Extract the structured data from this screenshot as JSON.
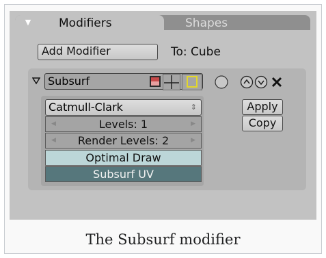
{
  "tabs": {
    "modifiers_label": "Modifiers",
    "shapes_label": "Shapes"
  },
  "toolbar": {
    "add_modifier_label": "Add Modifier",
    "target_label": "To: Cube"
  },
  "modifier": {
    "name": "Subsurf",
    "subdivision_type": "Catmull-Clark",
    "levels_label": "Levels: 1",
    "render_levels_label": "Render Levels: 2",
    "optimal_draw_label": "Optimal Draw",
    "subsurf_uv_label": "Subsurf UV",
    "apply_label": "Apply",
    "copy_label": "Copy"
  },
  "caption": "The Subsurf modifier",
  "icons": {
    "collapse": "triangle-down-icon",
    "modifier_expand": "triangle-down-icon",
    "render": "render-icon",
    "editmode": "editmode-icon",
    "cage": "cage-icon",
    "circle": "circle-icon",
    "move_up": "arrow-up-icon",
    "move_down": "arrow-down-icon",
    "delete": "close-icon"
  },
  "colors": {
    "panel_bg": "#c2c2c2",
    "tab_inactive": "#8f8f8f",
    "toggle_on": "#bcd6d8",
    "toggle_dark": "#56777c",
    "render_icon": "#c74a4a",
    "cage_icon": "#e3d72a"
  }
}
